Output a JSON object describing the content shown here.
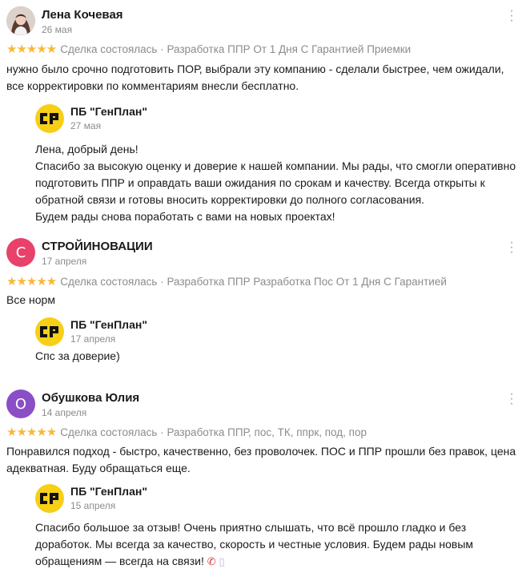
{
  "reviews": [
    {
      "author": "Лена Кочевая",
      "date": "26 мая",
      "avatar": {
        "type": "photo"
      },
      "stars": "★★★★★",
      "meta": "Сделка состоялась · Разработка ППР От 1 Дня С Гарантией Приемки",
      "text": "нужно было срочно подготовить ПОР, выбрали эту компанию - сделали быстрее, чем ожидали, все корректировки по комментариям внесли бесплатно.",
      "reply": {
        "author": "ПБ \"ГенПлан\"",
        "date": "27 мая",
        "lines": [
          "Лена, добрый день!",
          "Спасибо за высокую оценку и доверие к нашей компании. Мы рады, что смогли оперативно подготовить ППР и оправдать ваши ожидания по срокам и качеству. Всегда открыты к обратной связи и готовы вносить корректировки до полного согласования.",
          "Будем рады снова поработать с вами на новых проектах!"
        ]
      }
    },
    {
      "author": "СТРОЙИНОВАЦИИ",
      "date": "17 апреля",
      "avatar": {
        "type": "letter",
        "letter": "С",
        "color": "#e8416a"
      },
      "stars": "★★★★★",
      "meta": "Сделка состоялась · Разработка ППР Разработка Пос От 1 Дня С Гарантией",
      "text": "Все норм",
      "reply": {
        "author": "ПБ \"ГенПлан\"",
        "date": "17 апреля",
        "lines": [
          "Спс за доверие)"
        ]
      }
    },
    {
      "author": "Обушкова Юлия",
      "date": "14 апреля",
      "avatar": {
        "type": "letter",
        "letter": "О",
        "color": "#8a4fc7"
      },
      "stars": "★★★★★",
      "meta": "Сделка состоялась · Разработка ППР, пос, ТК, ппрк, под, пор",
      "text": "Понравился подход - быстро, качественно, без проволочек. ПОС и ППР прошли без правок, цена адекватная. Буду обращаться еще.",
      "reply": {
        "author": "ПБ \"ГенПлан\"",
        "date": "15 апреля",
        "lines": [
          "Спасибо большое за отзыв! Очень приятно слышать, что всё прошло гладко и без доработок. Мы всегда за качество, скорость и честные условия. Будем рады новым обращениям — всегда на связи!"
        ],
        "emojis": [
          "phone-icon",
          "document-icon"
        ]
      }
    }
  ],
  "brand_color": "#f7cf16",
  "star_color": "#f8b936"
}
